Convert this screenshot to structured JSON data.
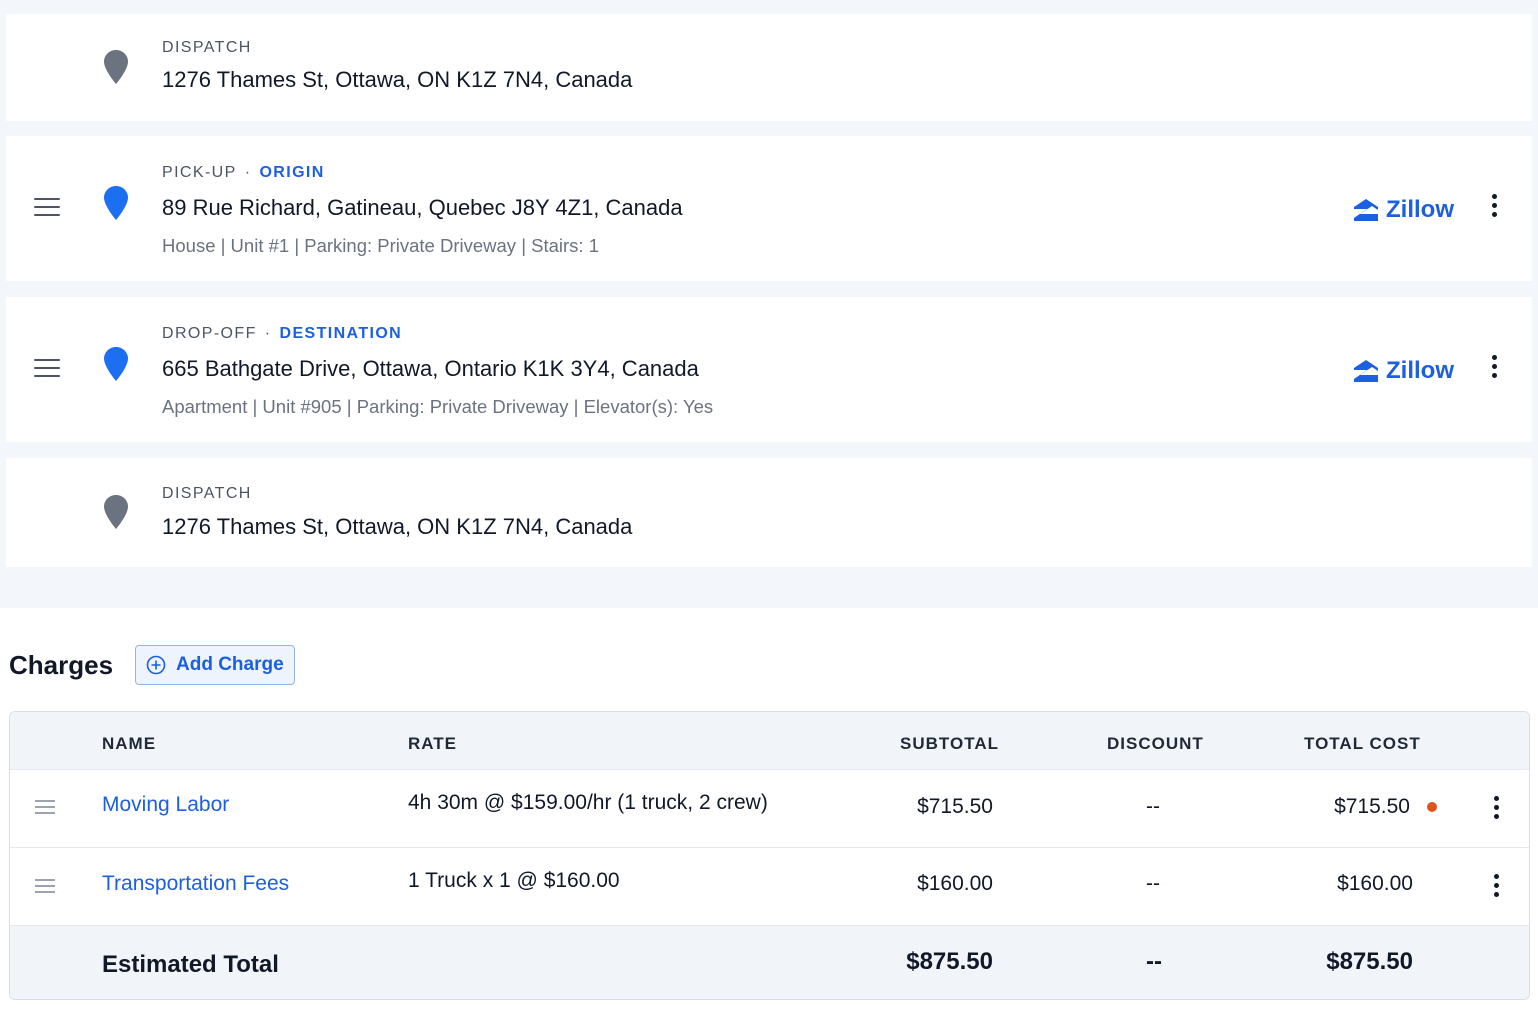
{
  "stops": [
    {
      "label": "DISPATCH",
      "role": "",
      "address": "1276 Thames St, Ottawa, ON K1Z 7N4, Canada",
      "details": "",
      "pin_color": "#6b7280"
    },
    {
      "label": "PICK-UP",
      "role": "ORIGIN",
      "address": "89 Rue Richard, Gatineau, Quebec J8Y 4Z1, Canada",
      "details": "House | Unit #1 | Parking: Private Driveway | Stairs: 1",
      "pin_color": "#1d6ff2",
      "zillow": "Zillow"
    },
    {
      "label": "DROP-OFF",
      "role": "DESTINATION",
      "address": "665 Bathgate Drive, Ottawa, Ontario K1K 3Y4, Canada",
      "details": "Apartment | Unit #905 | Parking: Private Driveway | Elevator(s): Yes",
      "pin_color": "#1d6ff2",
      "zillow": "Zillow"
    },
    {
      "label": "DISPATCH",
      "role": "",
      "address": "1276 Thames St, Ottawa, ON K1Z 7N4, Canada",
      "details": "",
      "pin_color": "#6b7280"
    }
  ],
  "charges": {
    "title": "Charges",
    "add_label": "Add Charge",
    "columns": {
      "name": "NAME",
      "rate": "RATE",
      "subtotal": "SUBTOTAL",
      "discount": "DISCOUNT",
      "total": "TOTAL COST"
    },
    "rows": [
      {
        "name": "Moving Labor",
        "rate": "4h 30m @ $159.00/hr (1 truck, 2 crew)",
        "subtotal": "$715.50",
        "discount": "--",
        "total": "$715.50",
        "flag": true
      },
      {
        "name": "Transportation Fees",
        "rate": "1 Truck x 1 @ $160.00",
        "subtotal": "$160.00",
        "discount": "--",
        "total": "$160.00",
        "flag": false
      }
    ],
    "footer": {
      "label": "Estimated Total",
      "subtotal": "$875.50",
      "discount": "--",
      "total": "$875.50"
    }
  },
  "colors": {
    "accent": "#1d5fe0",
    "flag": "#e0531b"
  }
}
